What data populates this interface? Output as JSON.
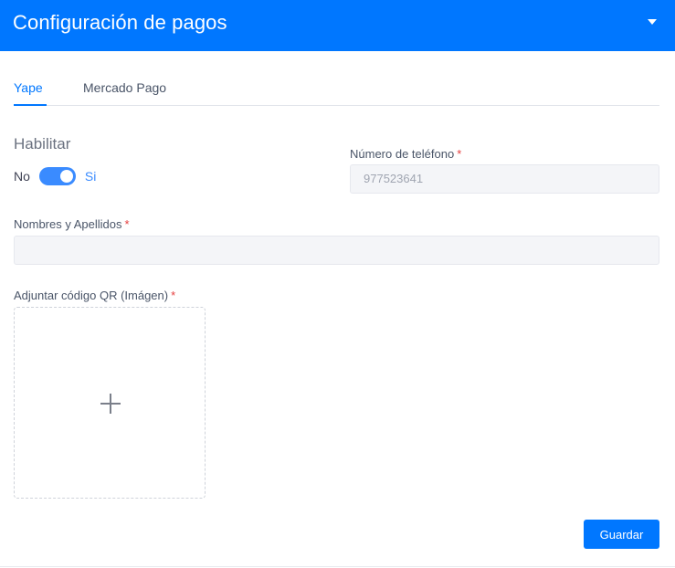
{
  "header": {
    "title": "Configuración de pagos",
    "collapse_icon": "caret-down-icon"
  },
  "tabs": [
    {
      "label": "Yape",
      "active": true
    },
    {
      "label": "Mercado Pago",
      "active": false
    }
  ],
  "enable": {
    "title": "Habilitar",
    "off_label": "No",
    "on_label": "Si",
    "enabled": true
  },
  "form": {
    "phone": {
      "label": "Número de teléfono",
      "required_mark": "*",
      "value": "977523641"
    },
    "names": {
      "label": "Nombres y Apellidos",
      "required_mark": "*",
      "value": ""
    },
    "qr": {
      "label": "Adjuntar código QR (Imágen)",
      "required_mark": "*",
      "icon": "plus-icon"
    }
  },
  "actions": {
    "save_label": "Guardar"
  },
  "colors": {
    "primary": "#0077ff",
    "toggle": "#3a8bff",
    "required": "#e53e3e"
  }
}
